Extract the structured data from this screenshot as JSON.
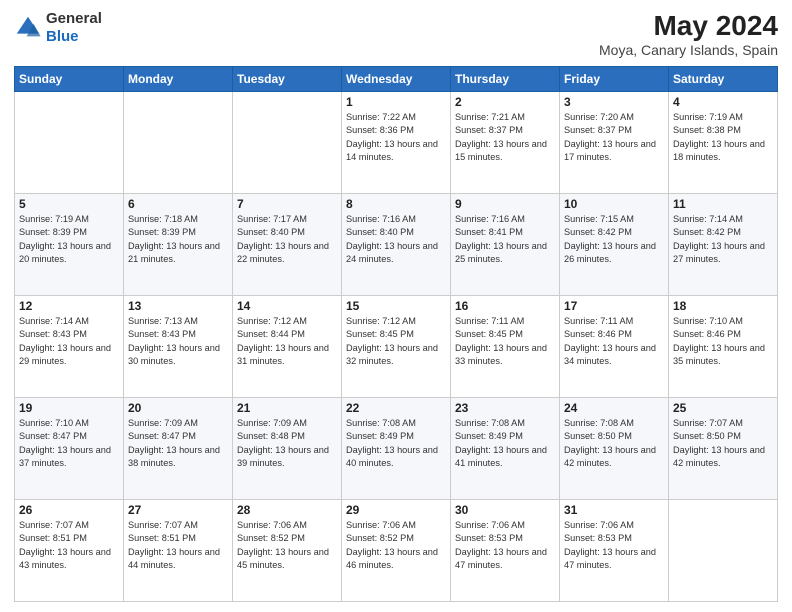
{
  "logo": {
    "general": "General",
    "blue": "Blue"
  },
  "header": {
    "title": "May 2024",
    "subtitle": "Moya, Canary Islands, Spain"
  },
  "weekdays": [
    "Sunday",
    "Monday",
    "Tuesday",
    "Wednesday",
    "Thursday",
    "Friday",
    "Saturday"
  ],
  "weeks": [
    [
      {
        "day": "",
        "info": ""
      },
      {
        "day": "",
        "info": ""
      },
      {
        "day": "",
        "info": ""
      },
      {
        "day": "1",
        "info": "Sunrise: 7:22 AM\nSunset: 8:36 PM\nDaylight: 13 hours and 14 minutes."
      },
      {
        "day": "2",
        "info": "Sunrise: 7:21 AM\nSunset: 8:37 PM\nDaylight: 13 hours and 15 minutes."
      },
      {
        "day": "3",
        "info": "Sunrise: 7:20 AM\nSunset: 8:37 PM\nDaylight: 13 hours and 17 minutes."
      },
      {
        "day": "4",
        "info": "Sunrise: 7:19 AM\nSunset: 8:38 PM\nDaylight: 13 hours and 18 minutes."
      }
    ],
    [
      {
        "day": "5",
        "info": "Sunrise: 7:19 AM\nSunset: 8:39 PM\nDaylight: 13 hours and 20 minutes."
      },
      {
        "day": "6",
        "info": "Sunrise: 7:18 AM\nSunset: 8:39 PM\nDaylight: 13 hours and 21 minutes."
      },
      {
        "day": "7",
        "info": "Sunrise: 7:17 AM\nSunset: 8:40 PM\nDaylight: 13 hours and 22 minutes."
      },
      {
        "day": "8",
        "info": "Sunrise: 7:16 AM\nSunset: 8:40 PM\nDaylight: 13 hours and 24 minutes."
      },
      {
        "day": "9",
        "info": "Sunrise: 7:16 AM\nSunset: 8:41 PM\nDaylight: 13 hours and 25 minutes."
      },
      {
        "day": "10",
        "info": "Sunrise: 7:15 AM\nSunset: 8:42 PM\nDaylight: 13 hours and 26 minutes."
      },
      {
        "day": "11",
        "info": "Sunrise: 7:14 AM\nSunset: 8:42 PM\nDaylight: 13 hours and 27 minutes."
      }
    ],
    [
      {
        "day": "12",
        "info": "Sunrise: 7:14 AM\nSunset: 8:43 PM\nDaylight: 13 hours and 29 minutes."
      },
      {
        "day": "13",
        "info": "Sunrise: 7:13 AM\nSunset: 8:43 PM\nDaylight: 13 hours and 30 minutes."
      },
      {
        "day": "14",
        "info": "Sunrise: 7:12 AM\nSunset: 8:44 PM\nDaylight: 13 hours and 31 minutes."
      },
      {
        "day": "15",
        "info": "Sunrise: 7:12 AM\nSunset: 8:45 PM\nDaylight: 13 hours and 32 minutes."
      },
      {
        "day": "16",
        "info": "Sunrise: 7:11 AM\nSunset: 8:45 PM\nDaylight: 13 hours and 33 minutes."
      },
      {
        "day": "17",
        "info": "Sunrise: 7:11 AM\nSunset: 8:46 PM\nDaylight: 13 hours and 34 minutes."
      },
      {
        "day": "18",
        "info": "Sunrise: 7:10 AM\nSunset: 8:46 PM\nDaylight: 13 hours and 35 minutes."
      }
    ],
    [
      {
        "day": "19",
        "info": "Sunrise: 7:10 AM\nSunset: 8:47 PM\nDaylight: 13 hours and 37 minutes."
      },
      {
        "day": "20",
        "info": "Sunrise: 7:09 AM\nSunset: 8:47 PM\nDaylight: 13 hours and 38 minutes."
      },
      {
        "day": "21",
        "info": "Sunrise: 7:09 AM\nSunset: 8:48 PM\nDaylight: 13 hours and 39 minutes."
      },
      {
        "day": "22",
        "info": "Sunrise: 7:08 AM\nSunset: 8:49 PM\nDaylight: 13 hours and 40 minutes."
      },
      {
        "day": "23",
        "info": "Sunrise: 7:08 AM\nSunset: 8:49 PM\nDaylight: 13 hours and 41 minutes."
      },
      {
        "day": "24",
        "info": "Sunrise: 7:08 AM\nSunset: 8:50 PM\nDaylight: 13 hours and 42 minutes."
      },
      {
        "day": "25",
        "info": "Sunrise: 7:07 AM\nSunset: 8:50 PM\nDaylight: 13 hours and 42 minutes."
      }
    ],
    [
      {
        "day": "26",
        "info": "Sunrise: 7:07 AM\nSunset: 8:51 PM\nDaylight: 13 hours and 43 minutes."
      },
      {
        "day": "27",
        "info": "Sunrise: 7:07 AM\nSunset: 8:51 PM\nDaylight: 13 hours and 44 minutes."
      },
      {
        "day": "28",
        "info": "Sunrise: 7:06 AM\nSunset: 8:52 PM\nDaylight: 13 hours and 45 minutes."
      },
      {
        "day": "29",
        "info": "Sunrise: 7:06 AM\nSunset: 8:52 PM\nDaylight: 13 hours and 46 minutes."
      },
      {
        "day": "30",
        "info": "Sunrise: 7:06 AM\nSunset: 8:53 PM\nDaylight: 13 hours and 47 minutes."
      },
      {
        "day": "31",
        "info": "Sunrise: 7:06 AM\nSunset: 8:53 PM\nDaylight: 13 hours and 47 minutes."
      },
      {
        "day": "",
        "info": ""
      }
    ]
  ]
}
